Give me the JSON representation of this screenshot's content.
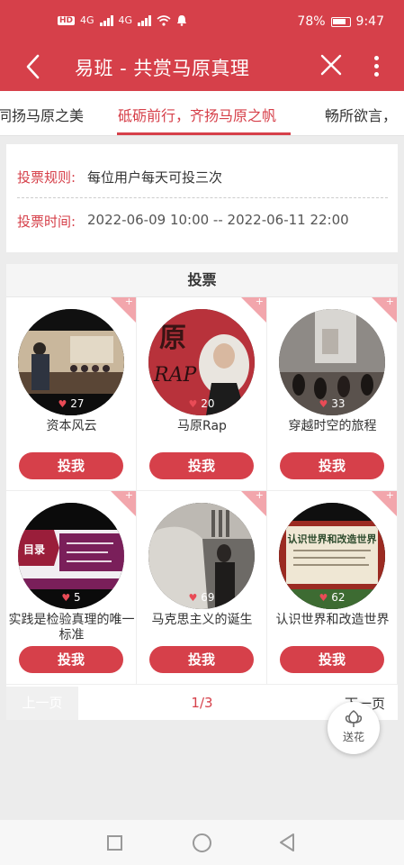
{
  "status_bar": {
    "battery": "78%",
    "time": "9:47",
    "network": "4G"
  },
  "app_bar": {
    "title": "易班 - 共赏马原真理",
    "back_icon": "chevron-left-icon",
    "close_icon": "close-icon",
    "more_icon": "more-vertical-icon"
  },
  "tabs": [
    {
      "label": "同扬马原之美",
      "active": false
    },
    {
      "label": "砥砺前行，齐扬马原之帆",
      "active": true
    },
    {
      "label": "畅所欲言，",
      "active": false
    }
  ],
  "rules": {
    "rule_label": "投票规则:",
    "rule_value": "每位用户每天可投三次",
    "time_label": "投票时间:",
    "time_value": "2022-06-09 10:00 -- 2022-06-11 22:00"
  },
  "vote": {
    "title": "投票",
    "button_label": "投我",
    "items": [
      {
        "name": "资本风云",
        "likes": "27"
      },
      {
        "name": "马原Rap",
        "likes": "20"
      },
      {
        "name": "穿越时空的旅程",
        "likes": "33"
      },
      {
        "name": "实践是检验真理的唯一标准",
        "likes": "5"
      },
      {
        "name": "马克思主义的诞生",
        "likes": "69"
      },
      {
        "name": "认识世界和改造世界",
        "likes": "62"
      }
    ],
    "thumb_texts": {
      "rap_char": "原",
      "rap_word": "RAP",
      "menu_title": "目录",
      "poster_title": "认识世界和改造世界"
    }
  },
  "pager": {
    "prev": "上一页",
    "indicator": "1/3",
    "next": "下一页"
  },
  "flower": {
    "label": "送花",
    "icon": "flower-icon"
  },
  "colors": {
    "brand": "#d6404a",
    "corner_badge": "#f2a6ac"
  }
}
